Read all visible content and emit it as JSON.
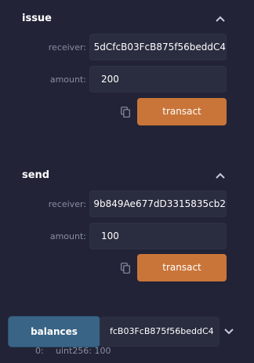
{
  "issue": {
    "title": "issue",
    "receiver_label": "receiver:",
    "receiver_value": "5dCfcB03FcB875f56beddC4",
    "amount_label": "amount:",
    "amount_value": "200",
    "transact_label": "transact"
  },
  "send": {
    "title": "send",
    "receiver_label": "receiver:",
    "receiver_value": "9b849Ae677dD3315835cb2",
    "amount_label": "amount:",
    "amount_value": "100",
    "transact_label": "transact"
  },
  "balances": {
    "button_label": "balances",
    "address_value": "fcB03FcB875f56beddC4",
    "output_index": "0:",
    "output_value": "uint256: 100"
  },
  "icons": {
    "collapse": "chevron-up-icon",
    "expand": "chevron-down-icon",
    "copy": "copy-icon"
  },
  "colors": {
    "background": "#222336",
    "transact_button": "#c97539",
    "balances_button": "#396486",
    "field_background": "#2a2c3f"
  }
}
